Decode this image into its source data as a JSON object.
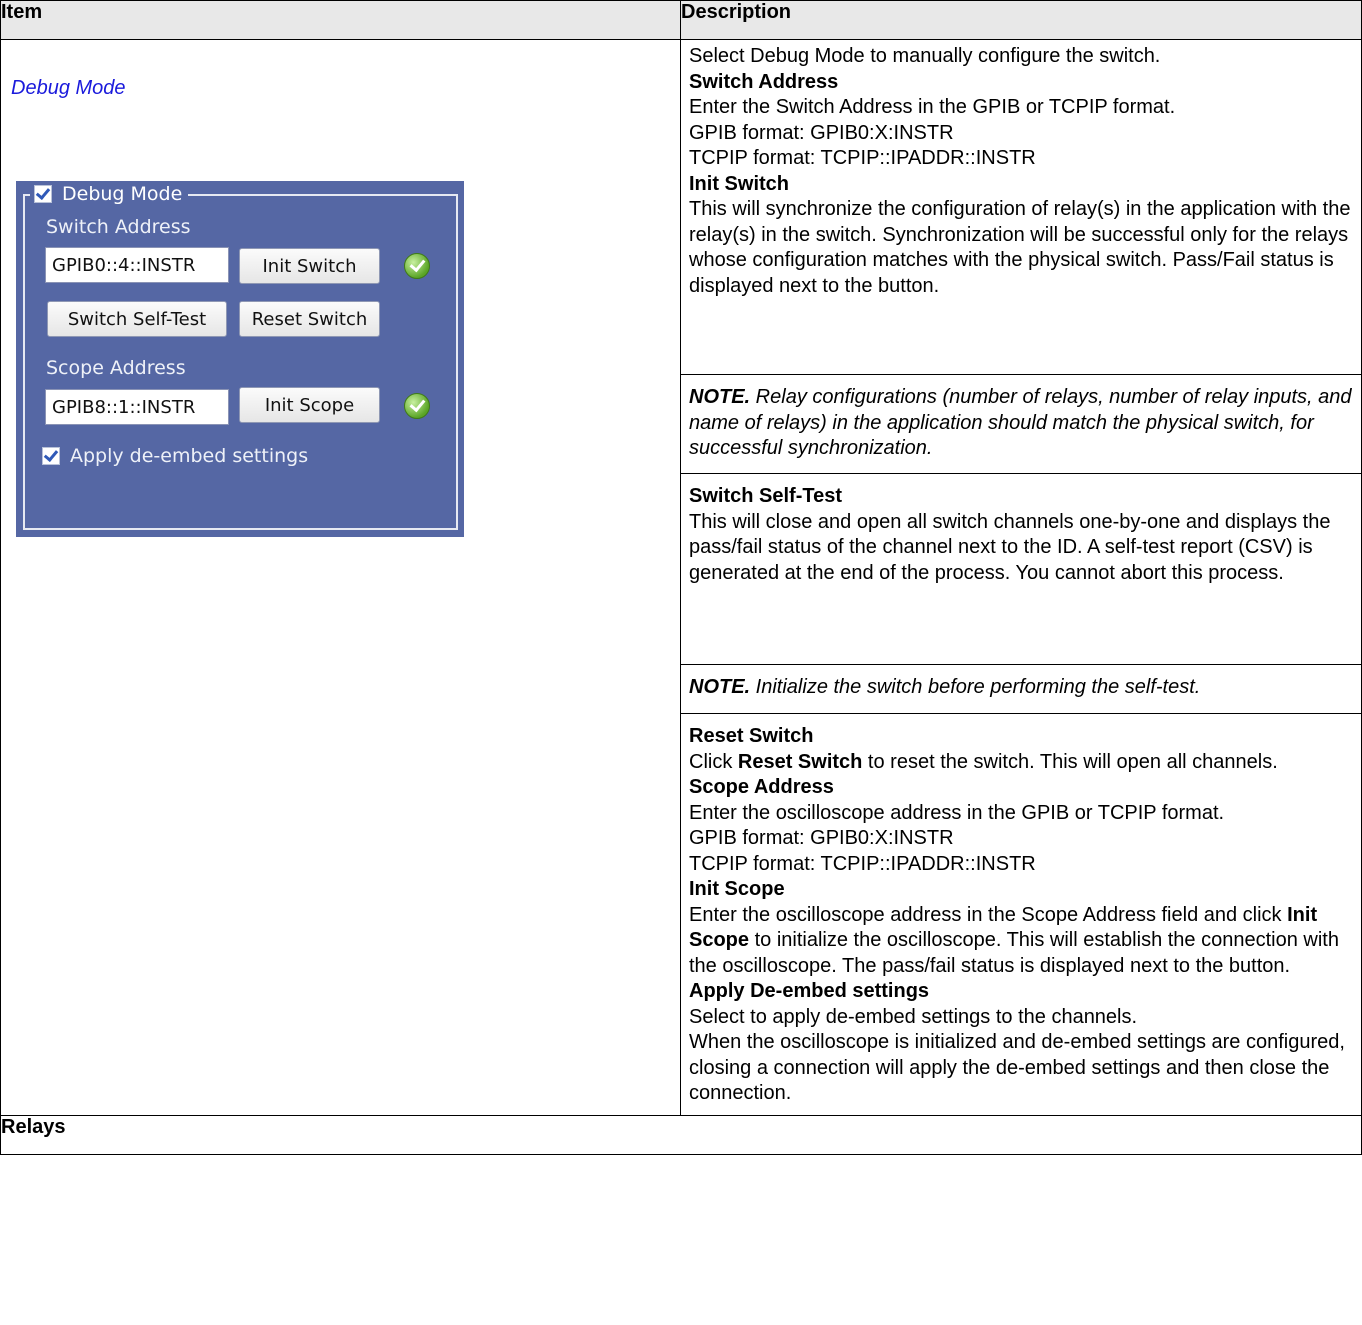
{
  "header": {
    "item": "Item",
    "description": "Description"
  },
  "item": {
    "link": "Debug Mode"
  },
  "panel": {
    "legend": "Debug Mode",
    "switch_address_label": "Switch Address",
    "switch_address_value": "GPIB0::4::INSTR",
    "init_switch": "Init Switch",
    "switch_self_test": "Switch Self-Test",
    "reset_switch": "Reset Switch",
    "scope_address_label": "Scope Address",
    "scope_address_value": "GPIB8::1::INSTR",
    "init_scope": "Init Scope",
    "apply_deembed": "Apply de-embed settings"
  },
  "desc": {
    "intro": "Select Debug Mode to manually configure the switch.",
    "switch_address_h": "Switch Address",
    "switch_address_1": "Enter the Switch Address in the GPIB or TCPIP format.",
    "switch_address_2": "GPIB format: GPIB0:X:INSTR",
    "switch_address_3": "TCPIP format: TCPIP::IPADDR::INSTR",
    "init_switch_h": "Init Switch",
    "init_switch_body": "This will synchronize the configuration of relay(s) in the application with the relay(s) in the switch. Synchronization will be successful only for the relays whose configuration matches with the physical switch. Pass/Fail status is displayed next to the button.",
    "note1_label": "NOTE.",
    "note1_body": " Relay configurations (number of relays, number of relay inputs, and name of relays) in the application should match the physical switch, for successful synchronization.",
    "self_test_h": "Switch Self-Test",
    "self_test_body": "This will close and open all switch channels one-by-one and displays the pass/fail status of the channel next to the ID. A self-test report (CSV) is generated at the end of the process. You cannot abort this process.",
    "note2_label": "NOTE.",
    "note2_body": " Initialize the switch before performing the self-test.",
    "reset_h": "Reset Switch",
    "reset_pre": "Click ",
    "reset_bold": "Reset Switch",
    "reset_post": " to reset the switch. This will open all channels.",
    "scope_address_h": "Scope Address",
    "scope_address_1": "Enter the oscilloscope address in the GPIB or TCPIP format.",
    "scope_address_2": "GPIB format: GPIB0:X:INSTR",
    "scope_address_3": "TCPIP format: TCPIP::IPADDR::INSTR",
    "init_scope_h": "Init Scope",
    "init_scope_pre": "Enter the oscilloscope address in the Scope Address field and click ",
    "init_scope_bold": "Init Scope",
    "init_scope_post": " to initialize the oscilloscope. This will establish the connection with the oscilloscope. The pass/fail status is displayed next to the button.",
    "deembed_h": "Apply De-embed settings",
    "deembed_1": "Select to apply de-embed settings to the channels.",
    "deembed_2": "When the oscilloscope is initialized and de-embed settings are configured, closing a connection will apply the de-embed settings and then close the connection."
  },
  "footer": {
    "relays": "Relays"
  }
}
